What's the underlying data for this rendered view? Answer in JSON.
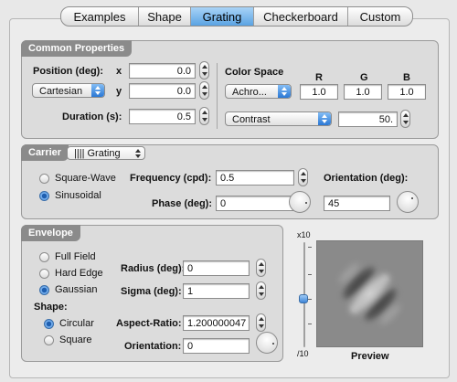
{
  "tabs": [
    {
      "label": "Examples",
      "active": false
    },
    {
      "label": "Shape",
      "active": false
    },
    {
      "label": "Grating",
      "active": true
    },
    {
      "label": "Checkerboard",
      "active": false
    },
    {
      "label": "Custom",
      "active": false
    }
  ],
  "common": {
    "title": "Common Properties",
    "position_label": "Position (deg):",
    "x_label": "x",
    "y_label": "y",
    "x_value": "0.0",
    "y_value": "0.0",
    "coord_mode": "Cartesian",
    "duration_label": "Duration (s):",
    "duration_value": "0.5",
    "color_space_label": "Color Space",
    "color_space_value": "Achro...",
    "r_label": "R",
    "g_label": "G",
    "b_label": "B",
    "r_value": "1.0",
    "g_value": "1.0",
    "b_value": "1.0",
    "contrast_mode": "Contrast",
    "contrast_value": "50."
  },
  "carrier": {
    "title": "Carrier",
    "type_value": "|||| Grating",
    "square_wave_label": "Square-Wave",
    "sinusoidal_label": "Sinusoidal",
    "waveform_selected": "Sinusoidal",
    "frequency_label": "Frequency (cpd):",
    "frequency_value": "0.5",
    "phase_label": "Phase (deg):",
    "phase_value": "0",
    "orientation_label": "Orientation (deg):",
    "orientation_value": "45"
  },
  "envelope": {
    "title": "Envelope",
    "full_field_label": "Full Field",
    "hard_edge_label": "Hard Edge",
    "gaussian_label": "Gaussian",
    "envelope_selected": "Gaussian",
    "shape_label": "Shape:",
    "circular_label": "Circular",
    "square_label": "Square",
    "shape_selected": "Circular",
    "radius_label": "Radius (deg):",
    "radius_value": "0",
    "sigma_label": "Sigma (deg):",
    "sigma_value": "1",
    "aspect_label": "Aspect-Ratio:",
    "aspect_value": "1.200000047",
    "orientation_label": "Orientation:",
    "orientation_value": "0"
  },
  "zoom": {
    "top_label": "x10",
    "bottom_label": "/10"
  },
  "preview": {
    "label": "Preview",
    "orientation_deg": 45
  },
  "colors": {
    "accent": "#4a90e0",
    "panel_header": "#8b8b8b"
  }
}
